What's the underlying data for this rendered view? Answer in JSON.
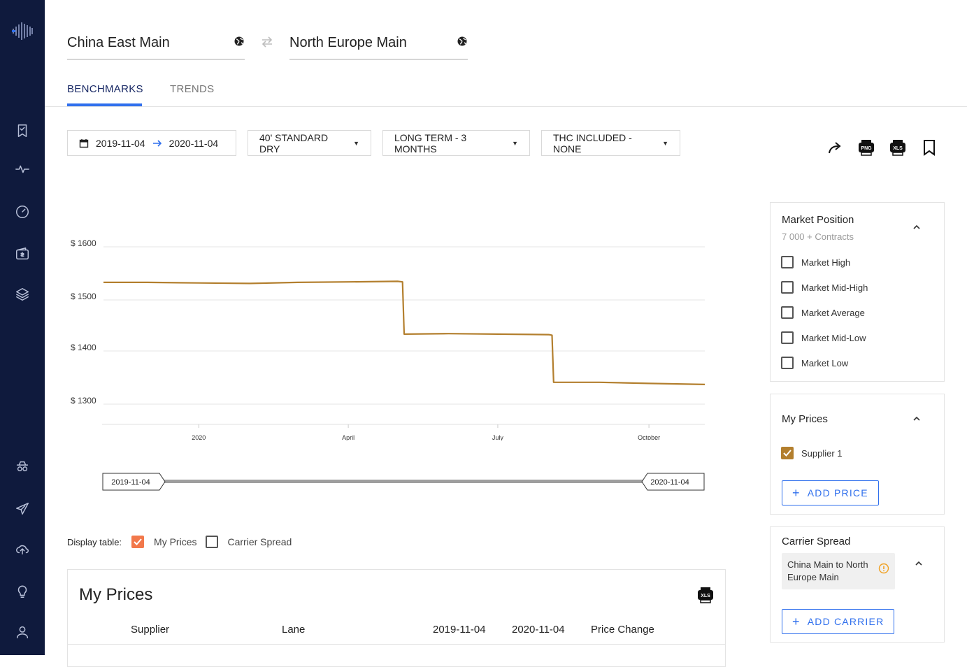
{
  "route": {
    "origin": "China East Main",
    "destination": "North Europe Main"
  },
  "tabs": [
    {
      "label": "BENCHMARKS",
      "active": true
    },
    {
      "label": "TRENDS",
      "active": false
    }
  ],
  "filters": {
    "date_from": "2019-11-04",
    "date_to": "2020-11-04",
    "container": "40' STANDARD DRY",
    "term": "LONG TERM - 3 MONTHS",
    "thc": "THC INCLUDED - NONE"
  },
  "toolbar": {
    "png_label": "PNG",
    "xls_label": "XLS"
  },
  "colors": {
    "accent": "#2f6fed",
    "sidebar": "#0f1a3d",
    "series": "#b37f2e",
    "checkbox_orange": "#f2784b"
  },
  "chart_data": {
    "type": "line",
    "y_tick_labels": [
      "$ 1600",
      "$ 1500",
      "$ 1400",
      "$ 1300"
    ],
    "y_ticks": [
      1600,
      1500,
      1400,
      1300
    ],
    "x_tick_labels": [
      "2020",
      "April",
      "July",
      "October"
    ],
    "x_ticks": [
      "2020-01-01",
      "2020-04-01",
      "2020-07-01",
      "2020-10-01"
    ],
    "xlim": [
      "2019-11-04",
      "2020-11-04"
    ],
    "ylim": [
      1265,
      1630
    ],
    "grid": true,
    "series": [
      {
        "color": "#b37f2e",
        "x": [
          "2019-11-04",
          "2019-12-01",
          "2020-01-01",
          "2020-02-01",
          "2020-03-01",
          "2020-04-01",
          "2020-05-01",
          "2020-05-04",
          "2020-05-05",
          "2020-06-01",
          "2020-07-01",
          "2020-08-01",
          "2020-08-03",
          "2020-08-04",
          "2020-09-01",
          "2020-10-01",
          "2020-11-04"
        ],
        "y": [
          1533,
          1533,
          1532,
          1531,
          1533,
          1534,
          1535,
          1534,
          1433,
          1434,
          1433,
          1432,
          1431,
          1341,
          1341,
          1339,
          1337
        ]
      }
    ],
    "range_start": "2019-11-04",
    "range_end": "2020-11-04"
  },
  "display_table": {
    "label": "Display table:",
    "options": [
      {
        "label": "My Prices",
        "checked": true
      },
      {
        "label": "Carrier Spread",
        "checked": false
      }
    ]
  },
  "my_prices_table": {
    "title": "My Prices",
    "columns": [
      "Supplier",
      "Lane",
      "2019-11-04",
      "2020-11-04",
      "Price Change"
    ]
  },
  "market_position": {
    "title": "Market Position",
    "subtitle": "7 000 + Contracts",
    "options": [
      {
        "label": "Market High",
        "checked": false
      },
      {
        "label": "Market Mid-High",
        "checked": false
      },
      {
        "label": "Market Average",
        "checked": false
      },
      {
        "label": "Market Mid-Low",
        "checked": false
      },
      {
        "label": "Market Low",
        "checked": false
      }
    ]
  },
  "my_prices_panel": {
    "title": "My Prices",
    "suppliers": [
      {
        "label": "Supplier 1",
        "checked": true
      }
    ],
    "add_label": "ADD PRICE"
  },
  "carrier_spread": {
    "title": "Carrier Spread",
    "lane_chip": "China Main to North Europe Main",
    "add_label": "ADD CARRIER"
  }
}
